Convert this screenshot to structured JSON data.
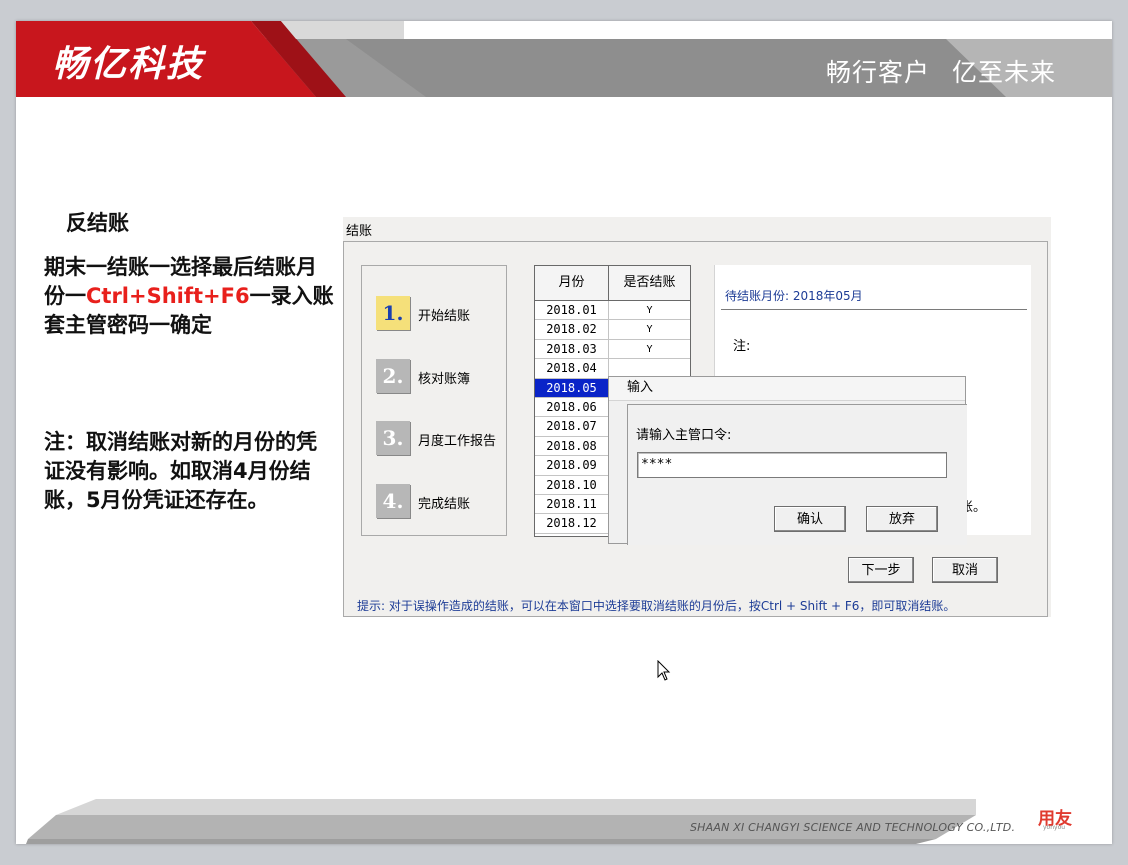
{
  "header": {
    "logo_text": "畅亿科技",
    "slogan_1": "畅行客户",
    "slogan_2": "亿至未来"
  },
  "left_text": {
    "title": "反结账",
    "steps_part1": "期末一结账一选择最后结账月份一",
    "steps_shortcut": "Ctrl+Shift+F6",
    "steps_part2": "一录入账套主管密码一确定",
    "note": "注：取消结账对新的月份的凭证没有影响。如取消4月份结账，5月份凭证还存在。"
  },
  "dialog": {
    "title": "结账",
    "steps": [
      {
        "number": "1.",
        "label": "开始结账",
        "active": true
      },
      {
        "number": "2.",
        "label": "核对账簿",
        "active": false
      },
      {
        "number": "3.",
        "label": "月度工作报告",
        "active": false
      },
      {
        "number": "4.",
        "label": "完成结账",
        "active": false
      }
    ],
    "table_headers": {
      "month": "月份",
      "closed": "是否结账"
    },
    "months": [
      {
        "month": "2018.01",
        "closed": "Y"
      },
      {
        "month": "2018.02",
        "closed": "Y"
      },
      {
        "month": "2018.03",
        "closed": "Y"
      },
      {
        "month": "2018.04",
        "closed": ""
      },
      {
        "month": "2018.05",
        "closed": "",
        "selected": true
      },
      {
        "month": "2018.06",
        "closed": ""
      },
      {
        "month": "2018.07",
        "closed": ""
      },
      {
        "month": "2018.08",
        "closed": ""
      },
      {
        "month": "2018.09",
        "closed": ""
      },
      {
        "month": "2018.10",
        "closed": ""
      },
      {
        "month": "2018.11",
        "closed": ""
      },
      {
        "month": "2018.12",
        "closed": ""
      }
    ],
    "pending_month": "待结账月份: 2018年05月",
    "note_label": "注:",
    "frag_1": "。",
    "frag_2": "。",
    "frag_3": "结账。",
    "next_button": "下一步",
    "cancel_button": "取消",
    "hint": "提示: 对于误操作造成的结账，可以在本窗口中选择要取消结账的月份后，按Ctrl + Shift + F6，即可取消结账。"
  },
  "input_popup": {
    "title": "输入",
    "label": "请输入主管口令:",
    "value": "****",
    "ok_button": "确认",
    "cancel_button": "放弃"
  },
  "footer": {
    "company": "SHAAN XI  CHANGYI  SCIENCE AND TECHNOLOGY CO.,LTD.",
    "brand": "用友",
    "brand_sub": "yonyou"
  },
  "colors": {
    "brand_red": "#c8161d",
    "highlight_red": "#e8201c",
    "selection_blue": "#0a24c8",
    "dialog_text_blue": "#1d3c96"
  }
}
